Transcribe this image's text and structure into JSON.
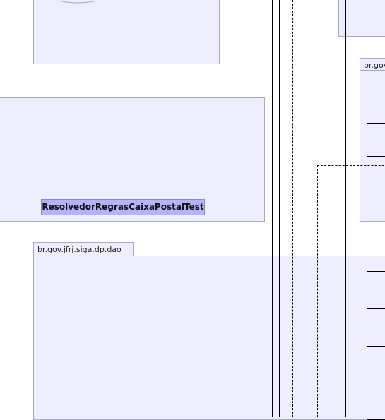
{
  "diagram": {
    "packages": [
      {
        "label": "br.gov.jfrj.siga.dp.dao"
      },
      {
        "label": "br.gov"
      }
    ],
    "classes": [
      {
        "label": "ResolvedorRegrasCaixaPostalTest"
      }
    ]
  },
  "colors": {
    "package_fill": "#eeeeff",
    "package_border": "#a9a9c9",
    "class_fill": "#b3b3ff",
    "line": "#000000"
  }
}
